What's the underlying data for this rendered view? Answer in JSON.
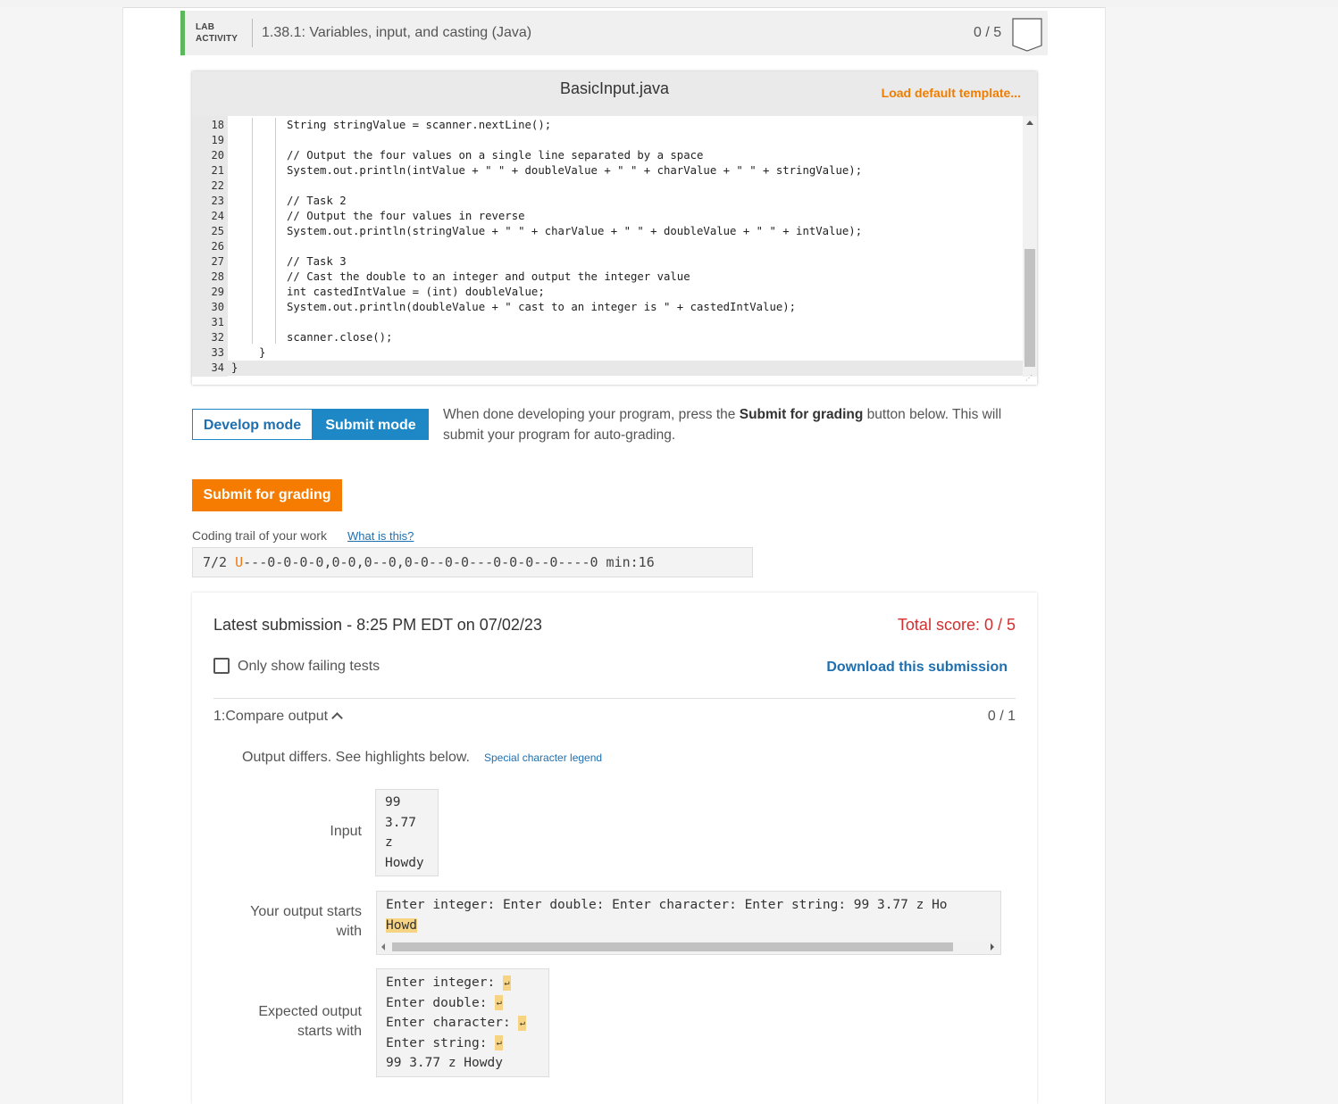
{
  "header": {
    "lab_label_1": "LAB",
    "lab_label_2": "ACTIVITY",
    "title": "1.38.1: Variables, input, and casting (Java)",
    "score": "0 / 5"
  },
  "editor": {
    "file_name": "BasicInput.java",
    "load_template": "Load default template...",
    "lines": [
      {
        "num": "18",
        "code": "String stringValue = scanner.nextLine();"
      },
      {
        "num": "19",
        "code": ""
      },
      {
        "num": "20",
        "code": "// Output the four values on a single line separated by a space"
      },
      {
        "num": "21",
        "code": "System.out.println(intValue + \" \" + doubleValue + \" \" + charValue + \" \" + stringValue);"
      },
      {
        "num": "22",
        "code": ""
      },
      {
        "num": "23",
        "code": "// Task 2"
      },
      {
        "num": "24",
        "code": "// Output the four values in reverse"
      },
      {
        "num": "25",
        "code": "System.out.println(stringValue + \" \" + charValue + \" \" + doubleValue + \" \" + intValue);"
      },
      {
        "num": "26",
        "code": ""
      },
      {
        "num": "27",
        "code": "// Task 3"
      },
      {
        "num": "28",
        "code": "// Cast the double to an integer and output the integer value"
      },
      {
        "num": "29",
        "code": "int castedIntValue = (int) doubleValue;"
      },
      {
        "num": "30",
        "code": "System.out.println(doubleValue + \" cast to an integer is \" + castedIntValue);"
      },
      {
        "num": "31",
        "code": ""
      },
      {
        "num": "32",
        "code": "scanner.close();"
      },
      {
        "num": "33",
        "code": "}"
      },
      {
        "num": "34",
        "code": "}"
      }
    ]
  },
  "modes": {
    "develop": "Develop mode",
    "submit": "Submit mode",
    "description_1": "When done developing your program, press the ",
    "description_bold": "Submit for grading",
    "description_2": " button below. This will submit your program for auto-grading."
  },
  "submit_button": "Submit for grading",
  "trail": {
    "label": "Coding trail of your work",
    "link": "What is this?",
    "date": "7/2 ",
    "u": "U",
    "sequence": "---0-0-0-0,0-0,0--0,0-0--0-0---0-0-0--0----0 min:16"
  },
  "submission": {
    "latest": "Latest submission - 8:25 PM EDT on 07/02/23",
    "total": "Total score: 0 / 5",
    "only_failing": "Only show failing tests",
    "download": "Download this submission",
    "test_name": "1:Compare output",
    "test_score": "0 / 1",
    "differs": "Output differs. See highlights below.",
    "legend": "Special character legend",
    "input_label": "Input",
    "input_lines": [
      "99",
      "3.77",
      "z",
      "Howdy"
    ],
    "your_output_label_1": "Your output starts",
    "your_output_label_2": "with",
    "your_output_line": "Enter integer: Enter double: Enter character: Enter string: 99 3.77 z Ho",
    "your_output_highlight": "Howd",
    "expected_label_1": "Expected output",
    "expected_label_2": "starts with",
    "expected_lines": [
      "Enter integer: ",
      "Enter double: ",
      "Enter character: ",
      "Enter string: ",
      "99 3.77 z Howdy"
    ],
    "return_symbol": "↵"
  }
}
